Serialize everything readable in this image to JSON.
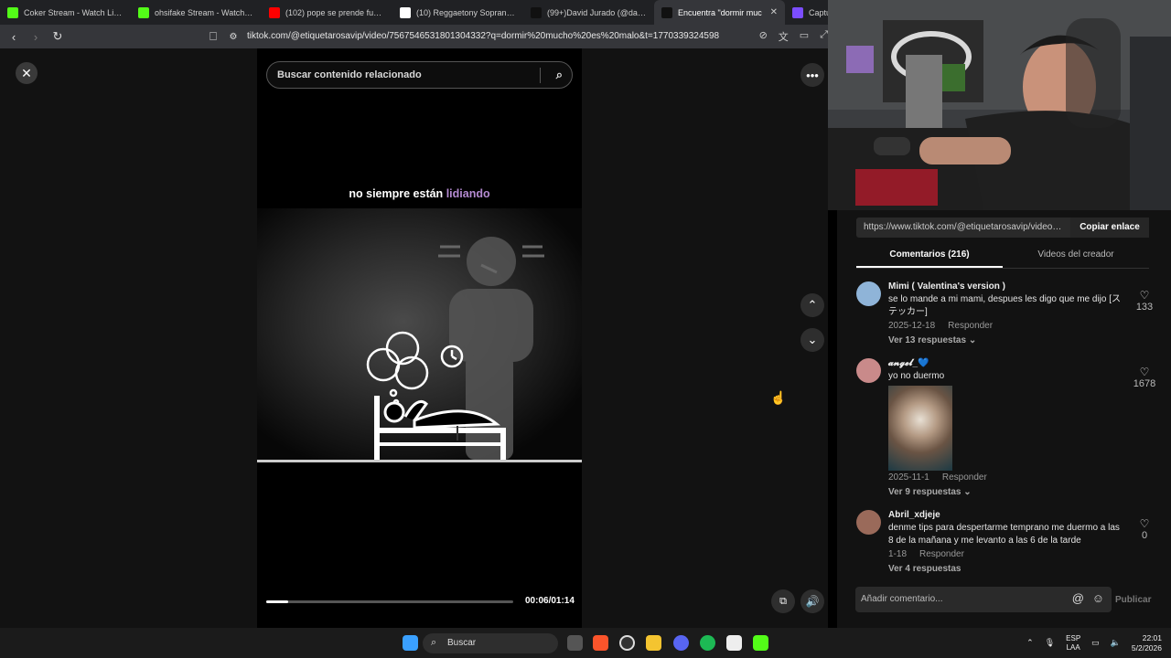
{
  "browser": {
    "tabs": [
      {
        "title": "Coker Stream - Watch Live o",
        "fav_color": "#53fc18"
      },
      {
        "title": "ohsifake Stream - Watch Live o",
        "fav_color": "#53fc18"
      },
      {
        "title": "(102) pope se prende fuego - Y",
        "fav_color": "#ff0000"
      },
      {
        "title": "(10) Reggaetony Soprano en X",
        "fav_color": "#ffffff"
      },
      {
        "title": "(99+)David Jurado (@davidju",
        "fav_color": "#111111"
      },
      {
        "title": "Encuentra \"dormir muc",
        "fav_color": "#111111"
      },
      {
        "title": "Captura",
        "fav_color": "#7c4dff"
      }
    ],
    "url": "tiktok.com/@etiquetarosavip/video/7567546531801304332?q=dormir%20mucho%20es%20malo&t=1770339324598"
  },
  "video": {
    "search_placeholder": "Buscar contenido relacionado",
    "caption_white": "no siempre están",
    "caption_highlight": "lidiando",
    "time": "00:06/01:14",
    "progress": 0.09
  },
  "panel": {
    "share_url": "https://www.tiktok.com/@etiquetarosavip/video/7...",
    "copy_label": "Copiar enlace",
    "tab_comments": "Comentarios (216)",
    "tab_creator": "Videos del creador",
    "comments": [
      {
        "name": "Mimi ( Valentina's version )",
        "text": "se lo mande a mi mami, despues les digo que me dijo [ステッカー]",
        "date": "2025-12-18",
        "reply": "Responder",
        "replies": "Ver 13 respuestas ⌄",
        "likes": "133",
        "avatar_color": "#8fb4d8"
      },
      {
        "name": "𝓪𝓷𝓰𝓮𝓵_💙",
        "text": "yo no duermo",
        "date": "2025-11-1",
        "reply": "Responder",
        "replies": "Ver 9 respuestas ⌄",
        "likes": "1678",
        "avatar_color": "#c98a8a"
      },
      {
        "name": "Abril_xdjeje",
        "text": "denme tips para despertarme temprano me duermo a las 8 de la mañana y me levanto a las 6 de la tarde",
        "date": "1-18",
        "reply": "Responder",
        "replies": "Ver 4 respuestas",
        "likes": "0",
        "avatar_color": "#9a6a5a"
      }
    ],
    "compose_placeholder": "Añadir comentario...",
    "post_label": "Publicar"
  },
  "taskbar": {
    "search_label": "Buscar",
    "lang_top": "ESP",
    "lang_bottom": "LAA",
    "time": "22:01",
    "date": "5/2/2026"
  }
}
